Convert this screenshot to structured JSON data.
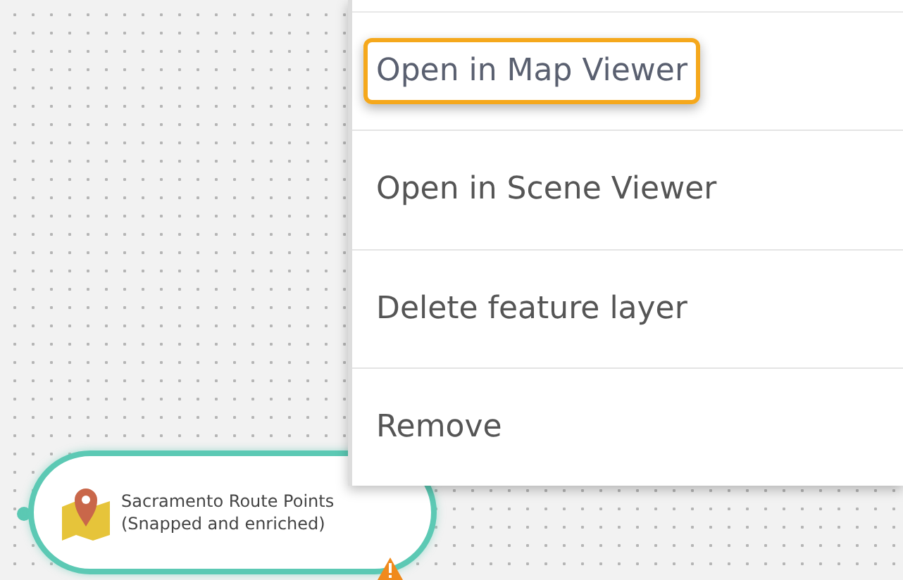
{
  "menu": {
    "items": [
      {
        "label": "Open in Map Viewer",
        "highlighted": true
      },
      {
        "label": "Open in Scene Viewer",
        "highlighted": false
      },
      {
        "label": "Delete feature layer",
        "highlighted": false
      },
      {
        "label": "Remove",
        "highlighted": false
      }
    ]
  },
  "node": {
    "lines": [
      "Sacramento Route Points",
      "(Snapped and enriched)"
    ],
    "warning": true
  }
}
